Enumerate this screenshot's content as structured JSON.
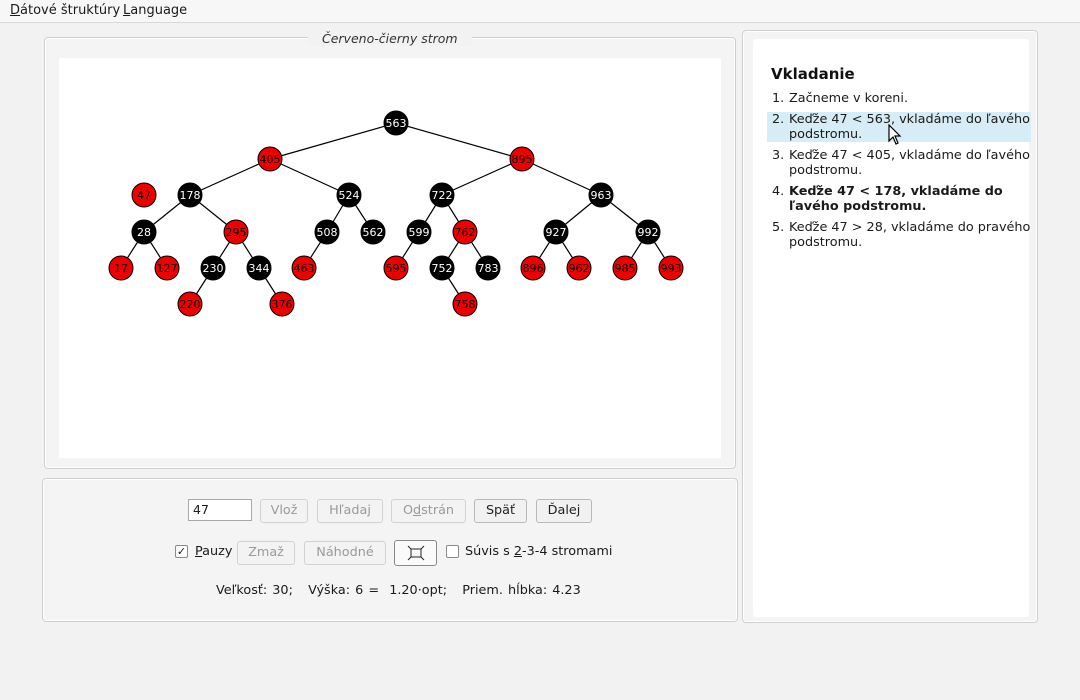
{
  "menu": {
    "items": [
      {
        "acc": "D",
        "rest": "átové štruktúry"
      },
      {
        "acc": "L",
        "rest": "anguage"
      }
    ]
  },
  "tree_panel": {
    "title": "Červeno-čierny strom"
  },
  "tree": {
    "colors": {
      "black": "#000000",
      "red": "#ee0000",
      "line": "#000000"
    },
    "pending_node": {
      "label": "47",
      "color": "red"
    },
    "nodes": [
      {
        "id": "563",
        "color": "black"
      },
      {
        "id": "405",
        "color": "red",
        "parent": "563"
      },
      {
        "id": "895",
        "color": "red",
        "parent": "563"
      },
      {
        "id": "178",
        "color": "black",
        "parent": "405"
      },
      {
        "id": "524",
        "color": "black",
        "parent": "405"
      },
      {
        "id": "722",
        "color": "black",
        "parent": "895"
      },
      {
        "id": "963",
        "color": "black",
        "parent": "895"
      },
      {
        "id": "28",
        "color": "black",
        "parent": "178"
      },
      {
        "id": "295",
        "color": "red",
        "parent": "178"
      },
      {
        "id": "508",
        "color": "black",
        "parent": "524"
      },
      {
        "id": "562",
        "color": "black",
        "parent": "524"
      },
      {
        "id": "599",
        "color": "black",
        "parent": "722"
      },
      {
        "id": "762",
        "color": "red",
        "parent": "722"
      },
      {
        "id": "927",
        "color": "black",
        "parent": "963"
      },
      {
        "id": "992",
        "color": "black",
        "parent": "963"
      },
      {
        "id": "17",
        "color": "red",
        "parent": "28"
      },
      {
        "id": "127",
        "color": "red",
        "parent": "28"
      },
      {
        "id": "230",
        "color": "black",
        "parent": "295"
      },
      {
        "id": "344",
        "color": "black",
        "parent": "295"
      },
      {
        "id": "463",
        "color": "red",
        "parent": "508"
      },
      {
        "id": "595",
        "color": "red",
        "parent": "599"
      },
      {
        "id": "752",
        "color": "black",
        "parent": "762"
      },
      {
        "id": "783",
        "color": "black",
        "parent": "762"
      },
      {
        "id": "896",
        "color": "red",
        "parent": "927"
      },
      {
        "id": "962",
        "color": "red",
        "parent": "927"
      },
      {
        "id": "985",
        "color": "red",
        "parent": "992"
      },
      {
        "id": "993",
        "color": "red",
        "parent": "992"
      },
      {
        "id": "220",
        "color": "red",
        "parent": "230"
      },
      {
        "id": "376",
        "color": "red",
        "parent": "344"
      },
      {
        "id": "758",
        "color": "red",
        "parent": "752"
      }
    ]
  },
  "controls": {
    "input_value": "47",
    "insert_label": "Vlož",
    "find_label": "Hľadaj",
    "delete_label": {
      "pre": "O",
      "acc": "d",
      "post": "strán"
    },
    "back_label": "Späť",
    "next_label": "Ďalej",
    "pauses": {
      "checked": true,
      "acc": "P",
      "rest": "auzy"
    },
    "clear_label": "Zmaž",
    "random_label": "Náhodné",
    "relation": {
      "checked": false,
      "pre": "Súvis s ",
      "acc": "2",
      "post": "-3-4 stromami"
    },
    "stats": "Veľkosť: 30;   Výška: 6 =  1.20·opt;   Priem. hĺbka: 4.23"
  },
  "explanation": {
    "title": "Vkladanie",
    "steps": [
      {
        "num": "1.",
        "text": "Začneme v koreni.",
        "style": "normal"
      },
      {
        "num": "2.",
        "text": "Keďže 47 < 563, vkladáme do ľavého podstromu.",
        "style": "highlight"
      },
      {
        "num": "3.",
        "text": "Keďže 47 < 405, vkladáme do ľavého podstromu.",
        "style": "normal"
      },
      {
        "num": "4.",
        "text": "Keďže 47 < 178, vkladáme do ľavého podstromu.",
        "style": "bold"
      },
      {
        "num": "5.",
        "text": "Keďže 47 > 28, vkladáme do pravého podstromu.",
        "style": "normal"
      }
    ]
  }
}
